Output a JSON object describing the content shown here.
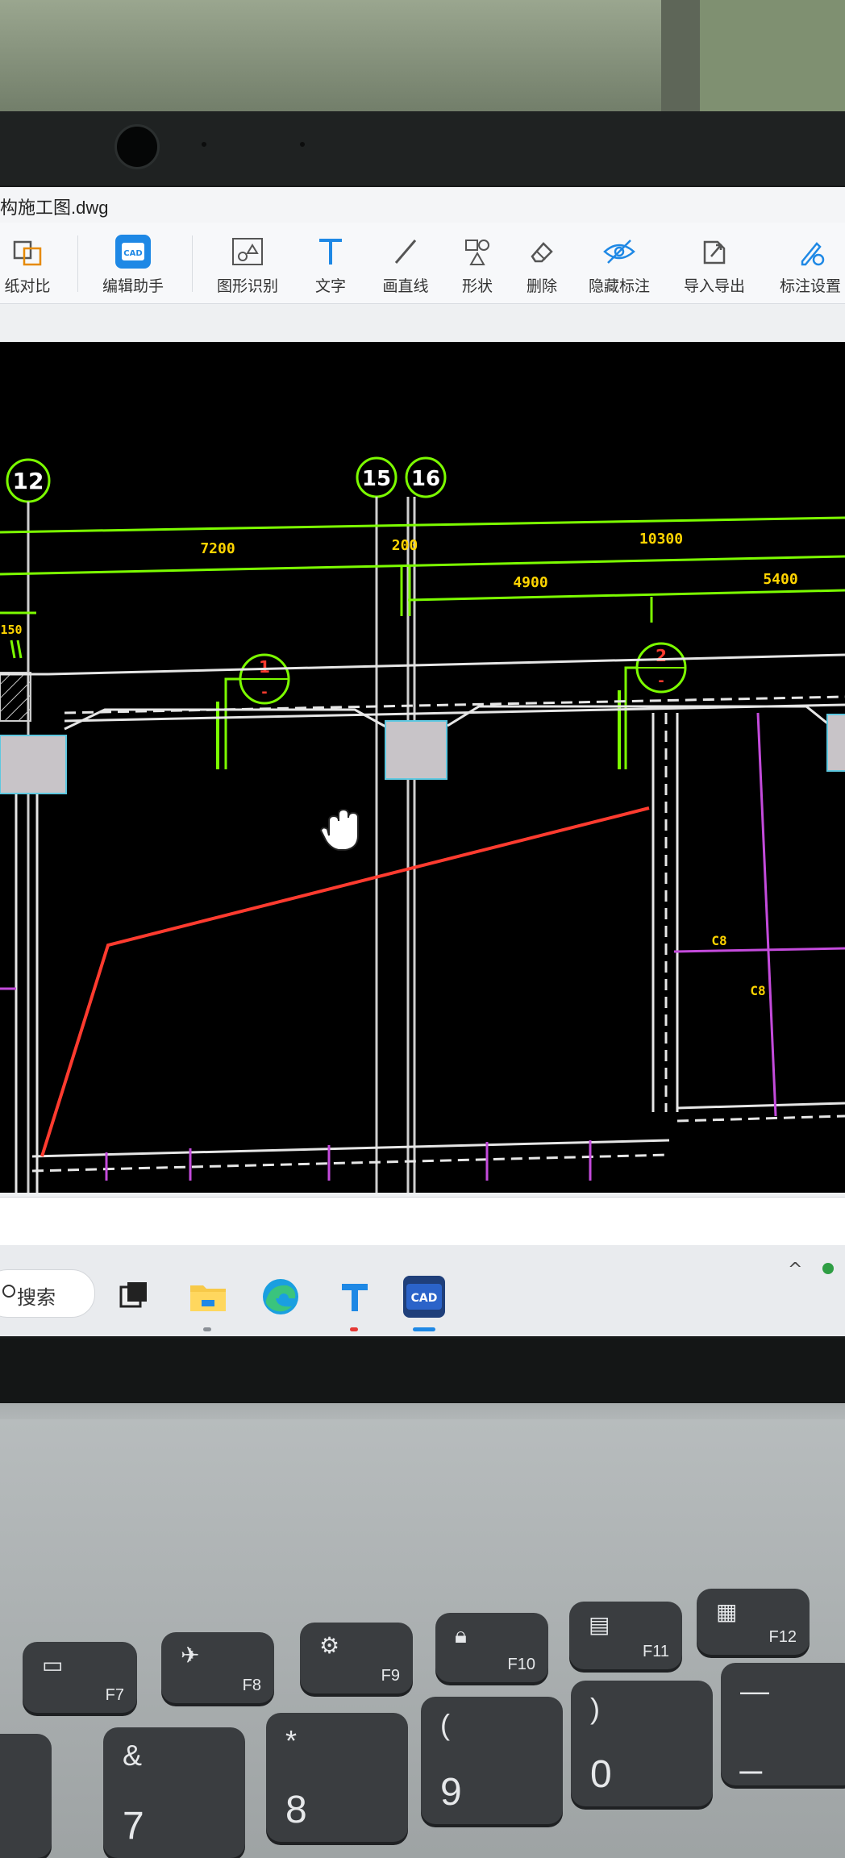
{
  "window": {
    "title": "构施工图.dwg"
  },
  "toolbar": {
    "items": [
      {
        "label": "纸对比",
        "icon": "compare-icon"
      },
      {
        "label": "编辑助手",
        "icon": "cad-assistant-icon"
      },
      {
        "label": "图形识别",
        "icon": "shape-recognize-icon"
      },
      {
        "label": "文字",
        "icon": "text-icon"
      },
      {
        "label": "画直线",
        "icon": "line-icon"
      },
      {
        "label": "形状",
        "icon": "shapes-icon"
      },
      {
        "label": "删除",
        "icon": "eraser-icon"
      },
      {
        "label": "隐藏标注",
        "icon": "eye-hidden-icon"
      },
      {
        "label": "导入导出",
        "icon": "import-export-icon"
      },
      {
        "label": "标注设置",
        "icon": "annotation-settings-icon"
      }
    ]
  },
  "drawing": {
    "axes": [
      "12",
      "15",
      "16"
    ],
    "dimensions": [
      "7200",
      "200",
      "10300",
      "4900",
      "5400",
      "150"
    ],
    "section_marks": [
      {
        "number": "1",
        "sub": "-"
      },
      {
        "number": "2",
        "sub": "-"
      }
    ],
    "small_labels": [
      "C8",
      "C8"
    ]
  },
  "taskbar": {
    "search_label": "搜索",
    "apps": [
      "task-view-icon",
      "file-explorer-icon",
      "edge-icon",
      "text-app-icon",
      "cad-app-icon"
    ]
  },
  "keyboard": {
    "fn_keys": [
      {
        "label": "F7",
        "icon": "display-icon"
      },
      {
        "label": "F8",
        "icon": "airplane-icon"
      },
      {
        "label": "F9",
        "icon": "gear-icon"
      },
      {
        "label": "F10",
        "icon": "lock-icon"
      },
      {
        "label": "F11",
        "icon": "multi-window-icon"
      },
      {
        "label": "F12",
        "icon": "calculator-icon"
      }
    ],
    "num_keys": [
      {
        "top": "&",
        "bottom": "7"
      },
      {
        "top": "*",
        "bottom": "8"
      },
      {
        "top": "(",
        "bottom": "9"
      },
      {
        "top": ")",
        "bottom": "0"
      },
      {
        "top": "—",
        "bottom": "_"
      }
    ]
  },
  "colors": {
    "cad_background": "#000000",
    "axis_green": "#7cfc00",
    "dimension_yellow": "#ffd400",
    "section_red": "#ff3b2f",
    "magenta": "#c44bdc",
    "wall_white": "#e6e6e6"
  }
}
